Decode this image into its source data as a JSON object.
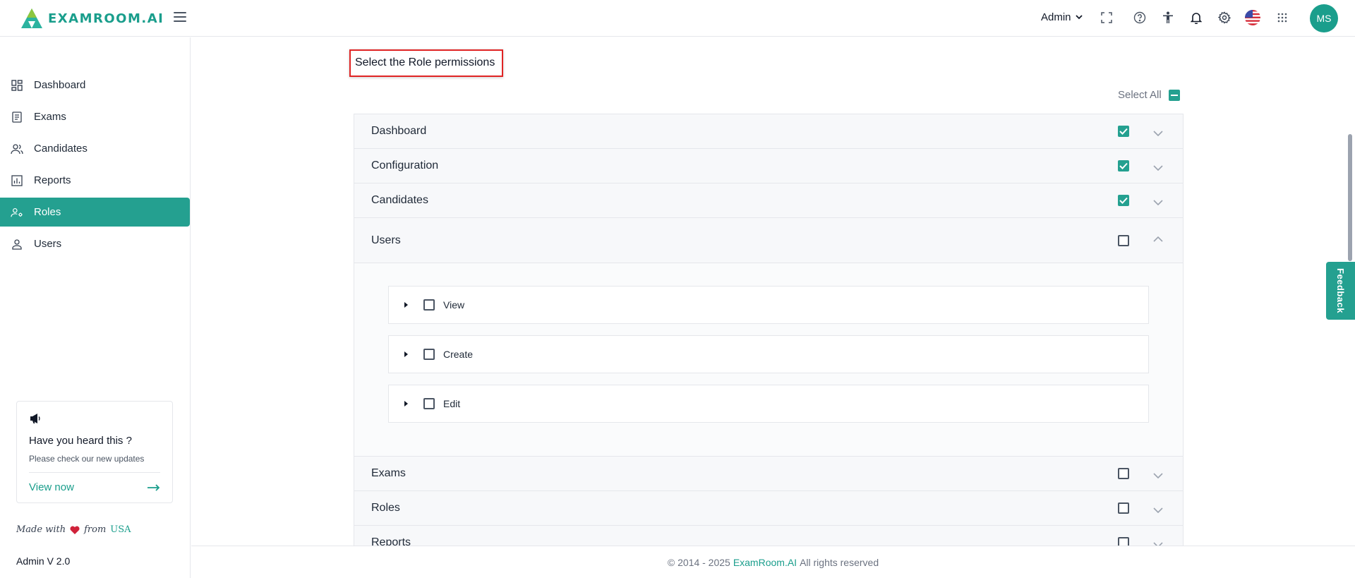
{
  "app": {
    "brand": "EXAMROOM.AI",
    "brand_color": "#1a9e8c"
  },
  "header": {
    "admin_label": "Admin",
    "avatar_initials": "MS",
    "icons": [
      "fullscreen-icon",
      "help-icon",
      "accessibility-icon",
      "bell-icon",
      "gear-icon",
      "us-flag-icon",
      "apps-grid-icon"
    ]
  },
  "sidebar": {
    "items": [
      {
        "label": "Dashboard",
        "icon": "dashboard-icon"
      },
      {
        "label": "Exams",
        "icon": "exams-icon"
      },
      {
        "label": "Candidates",
        "icon": "candidates-icon"
      },
      {
        "label": "Reports",
        "icon": "reports-icon"
      },
      {
        "label": "Roles",
        "icon": "roles-icon",
        "active": true
      },
      {
        "label": "Users",
        "icon": "users-icon"
      }
    ],
    "promo": {
      "title": "Have you heard this ?",
      "subtitle": "Please check our new updates",
      "link": "View now"
    },
    "made_with": "Made with",
    "from": "from",
    "country": "USA",
    "version": "Admin V 2.0"
  },
  "main": {
    "section_title": "Select the Role permissions",
    "select_all_label": "Select All",
    "permissions": [
      {
        "label": "Dashboard",
        "checked": true
      },
      {
        "label": "Configuration",
        "checked": true
      },
      {
        "label": "Candidates",
        "checked": true
      },
      {
        "label": "Users",
        "checked": false,
        "expanded": true,
        "children": [
          {
            "label": "View",
            "checked": false
          },
          {
            "label": "Create",
            "checked": false
          },
          {
            "label": "Edit",
            "checked": false
          }
        ]
      },
      {
        "label": "Exams",
        "checked": false
      },
      {
        "label": "Roles",
        "checked": false
      },
      {
        "label": "Reports",
        "checked": false
      }
    ]
  },
  "footer": {
    "prefix": "© 2014 - 2025",
    "brand": "ExamRoom.AI",
    "suffix": "All rights reserved"
  },
  "feedback_label": "Feedback",
  "colors": {
    "accent": "#24a090",
    "highlight_border": "#e02424"
  }
}
